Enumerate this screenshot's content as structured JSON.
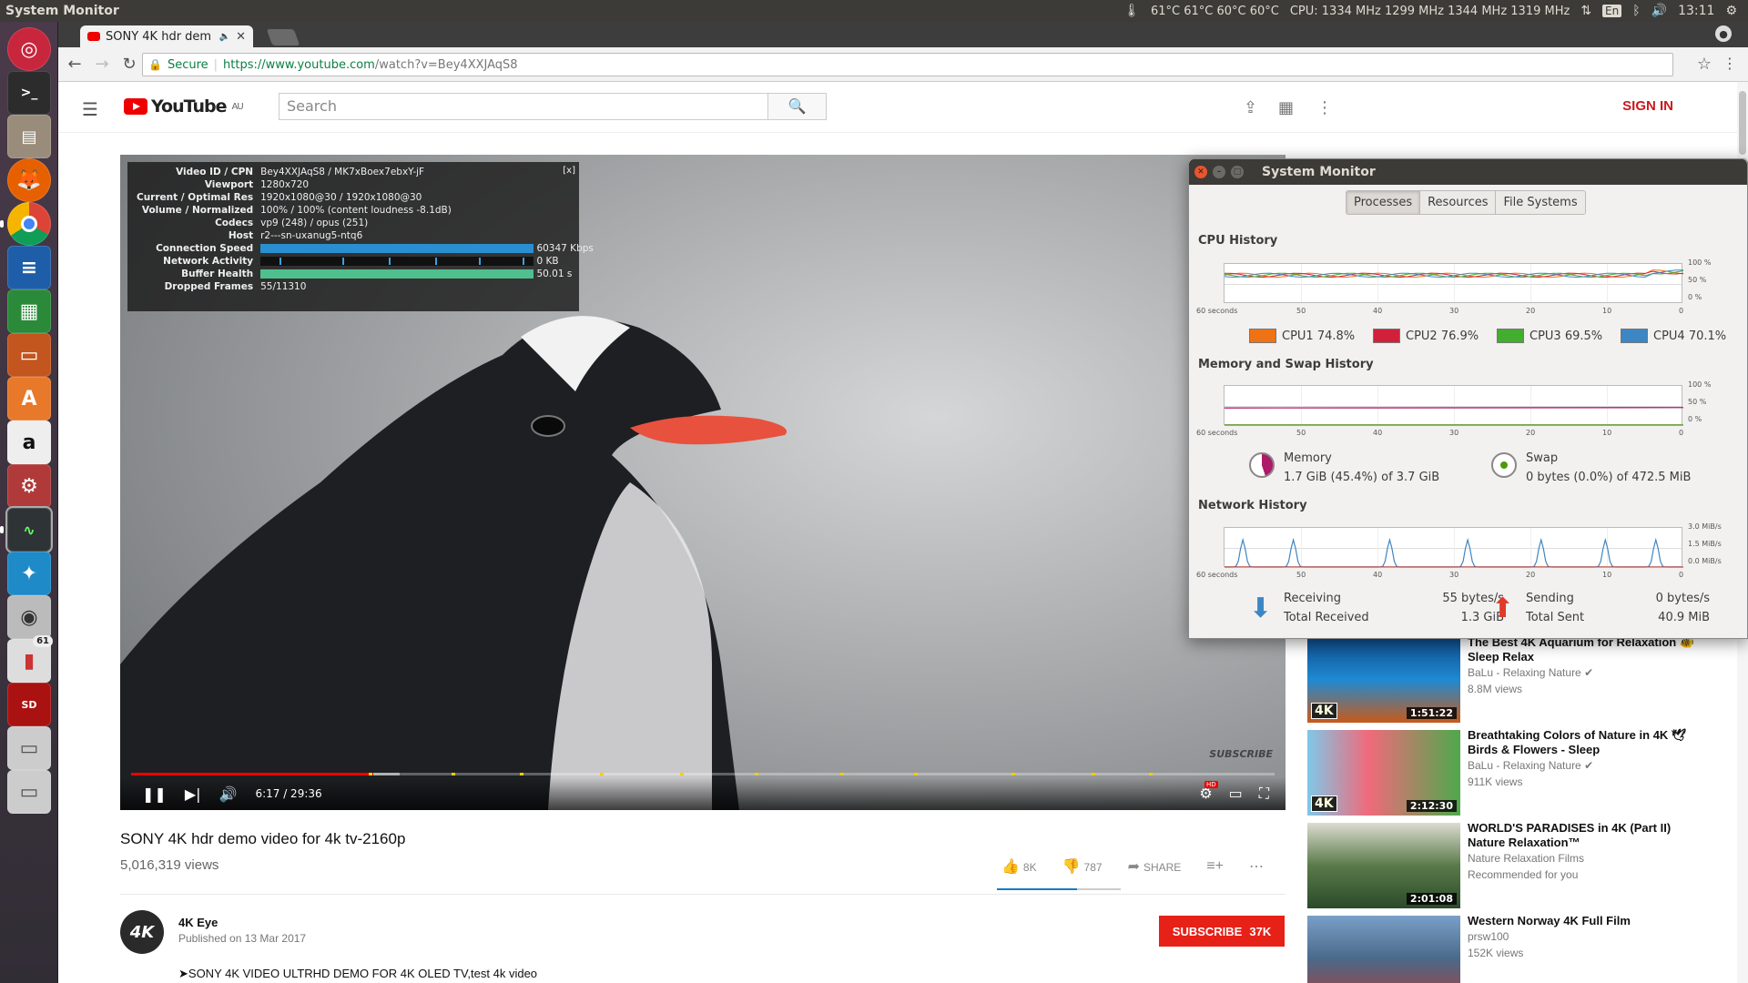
{
  "top_panel": {
    "app_title": "System Monitor",
    "temps": "61°C 61°C 60°C 60°C",
    "cpu_freq": "CPU: 1334 MHz 1299 MHz 1344 MHz 1319 MHz",
    "keyboard": "En",
    "time": "13:11"
  },
  "launcher": {
    "items": [
      "ubuntu-dash",
      "terminal",
      "files",
      "firefox",
      "chrome",
      "writer",
      "calc",
      "impress",
      "software-center",
      "amazon",
      "settings",
      "system-monitor",
      "kodi",
      "camera",
      "thermometer",
      "sd-card",
      "drive",
      "drive-2"
    ],
    "badge": "61",
    "sd_label": "SD"
  },
  "browser": {
    "tab_title": "SONY 4K hdr dem",
    "secure_label": "Secure",
    "url_host": "https://www.youtube.com",
    "url_path": "/watch?v=Bey4XXJAqS8"
  },
  "youtube": {
    "logo_text": "YouTube",
    "region": "AU",
    "search_placeholder": "Search",
    "sign_in": "SIGN IN"
  },
  "stats_overlay": {
    "rows": [
      {
        "k": "Video ID / CPN",
        "v": "Bey4XXJAqS8 / MK7xBoex7ebxY-jF"
      },
      {
        "k": "Viewport",
        "v": "1280x720"
      },
      {
        "k": "Current / Optimal Res",
        "v": "1920x1080@30 / 1920x1080@30"
      },
      {
        "k": "Volume / Normalized",
        "v": "100% / 100% (content loudness -8.1dB)"
      },
      {
        "k": "Codecs",
        "v": "vp9 (248) / opus (251)"
      },
      {
        "k": "Host",
        "v": "r2---sn-uxanug5-ntq6"
      }
    ],
    "bars": [
      {
        "k": "Connection Speed",
        "v": "60347 Kbps",
        "fill": 1.0
      },
      {
        "k": "Network Activity",
        "v": "0 KB",
        "fill": 0.0
      },
      {
        "k": "Buffer Health",
        "v": "50.01 s",
        "fill": 1.0
      }
    ],
    "dropped": {
      "k": "Dropped Frames",
      "v": "55/11310"
    },
    "close": "[x]"
  },
  "player": {
    "time": "6:17 / 29:36",
    "played_fraction": 0.212,
    "buffered_fraction": 0.235,
    "watermark": "SUBSCRIBE"
  },
  "video": {
    "title": "SONY 4K hdr demo video for 4k tv-2160p",
    "views": "5,016,319 views",
    "likes": "8K",
    "dislikes": "787",
    "share": "SHARE",
    "channel_avatar": "4K",
    "channel": "4K Eye",
    "published": "Published on 13 Mar 2017",
    "subscribe": "SUBSCRIBE",
    "subscribers": "37K",
    "description": "➤SONY 4K VIDEO ULTRHD DEMO FOR 4K OLED TV,test 4k video"
  },
  "related": [
    {
      "title": "The Best 4K Aquarium for Relaxation 🐠 Sleep Relax",
      "channel": "BaLu - Relaxing Nature ✔",
      "meta": "8.8M views",
      "duration": "1:51:22",
      "badge": "4K"
    },
    {
      "title": "Breathtaking Colors of Nature in 4K 🕊Birds & Flowers - Sleep",
      "channel": "BaLu - Relaxing Nature ✔",
      "meta": "911K views",
      "duration": "2:12:30",
      "badge": "4K"
    },
    {
      "title": "WORLD'S PARADISES in 4K (Part II) Nature Relaxation™",
      "channel": "Nature Relaxation Films",
      "meta": "Recommended for you",
      "duration": "2:01:08",
      "badge": ""
    },
    {
      "title": "Western Norway 4K Full Film",
      "channel": "prsw100",
      "meta": "152K views",
      "duration": "",
      "badge": ""
    }
  ],
  "system_monitor": {
    "title": "System Monitor",
    "tabs": [
      "Processes",
      "Resources",
      "File Systems"
    ],
    "cpu_header": "CPU History",
    "mem_header": "Memory and Swap History",
    "net_header": "Network History",
    "x_ticks": [
      "60 seconds",
      "50",
      "40",
      "30",
      "20",
      "10",
      "0"
    ],
    "cpu_y": [
      "100 %",
      "50 %",
      "0 %"
    ],
    "mem_y": [
      "100 %",
      "50 %",
      "0 %"
    ],
    "net_y": [
      "3.0 MiB/s",
      "1.5 MiB/s",
      "0.0 MiB/s"
    ],
    "cpu_legend": [
      {
        "name": "CPU1",
        "value": "74.8%",
        "color": "#ef7215"
      },
      {
        "name": "CPU2",
        "value": "76.9%",
        "color": "#d1203a"
      },
      {
        "name": "CPU3",
        "value": "69.5%",
        "color": "#42ad2e"
      },
      {
        "name": "CPU4",
        "value": "70.1%",
        "color": "#3d86c4"
      }
    ],
    "memory": {
      "label": "Memory",
      "value": "1.7 GiB (45.4%) of 3.7 GiB",
      "color": "#ad1a6a"
    },
    "swap": {
      "label": "Swap",
      "value": "0 bytes (0.0%) of 472.5 MiB",
      "color": "#4e9a06"
    },
    "receiving": {
      "label": "Receiving",
      "rate": "55 bytes/s",
      "total_label": "Total Received",
      "total": "1.3 GiB"
    },
    "sending": {
      "label": "Sending",
      "rate": "0 bytes/s",
      "total_label": "Total Sent",
      "total": "40.9 MiB"
    }
  }
}
